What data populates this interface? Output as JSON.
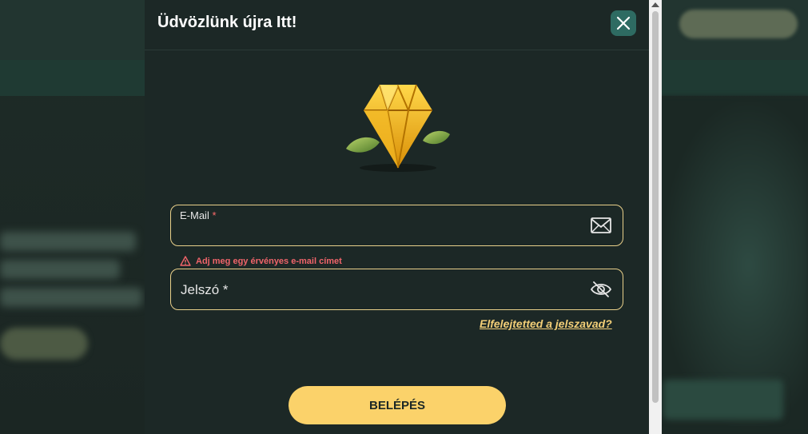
{
  "modal": {
    "title": "Üdvözlünk újra Itt!",
    "close_icon": "close-icon"
  },
  "form": {
    "email": {
      "label": "E-Mail",
      "required_mark": "*",
      "icon": "envelope-icon",
      "value": ""
    },
    "email_error": "Adj meg egy érvényes e-mail címet",
    "password": {
      "label": "Jelszó *",
      "icon": "eye-hidden-icon",
      "value": ""
    },
    "forgot_link": "Elfelejtetted a jelszavad?",
    "submit_label": "BELÉPÉS"
  },
  "colors": {
    "modal_bg": "#1c2826",
    "accent": "#fbd26a",
    "field_border": "#e9d08a",
    "error": "#f0646a",
    "close_bg": "#2e6b62"
  }
}
